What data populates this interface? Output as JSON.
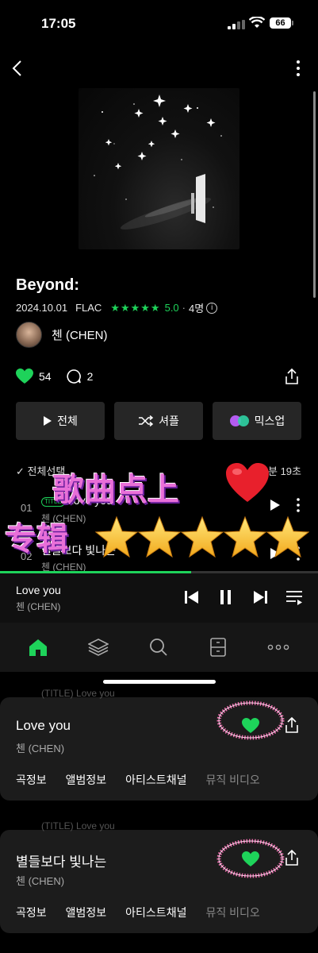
{
  "status": {
    "time": "17:05",
    "battery": "66"
  },
  "album": {
    "title": "Beyond:",
    "date": "2024.10.01",
    "format": "FLAC",
    "stars": "★★★★★",
    "rating": "5.0",
    "raters": "4명",
    "artist": "첸 (CHEN)",
    "likes": "54",
    "comments": "2"
  },
  "buttons": {
    "play_all": "전체",
    "shuffle": "셔플",
    "mixup": "믹스업"
  },
  "list": {
    "select_all": "전체선택",
    "duration": "곡 분 19초"
  },
  "tracks": [
    {
      "num": "01",
      "tag": "TITLE",
      "name": "Love you",
      "artist": "첸 (CHEN)"
    },
    {
      "num": "02",
      "name": "별들보다 빛나는",
      "artist": "첸 (CHEN)"
    }
  ],
  "overlay": {
    "line1": "歌曲点上",
    "line2": "专辑"
  },
  "progress": 0.6,
  "mini_player": {
    "song": "Love you",
    "artist": "첸 (CHEN)"
  },
  "cards": [
    {
      "peek_tag": "TITLE",
      "peek_name": "Love you",
      "title": "Love you",
      "artist": "첸 (CHEN)",
      "links": [
        "곡정보",
        "앨범정보",
        "아티스트채널",
        "뮤직 비디오"
      ]
    },
    {
      "peek_tag": "TITLE",
      "peek_name": "Love you",
      "title": "별들보다 빛나는",
      "artist": "첸 (CHEN)",
      "links": [
        "곡정보",
        "앨범정보",
        "아티스트채널",
        "뮤직 비디오"
      ]
    }
  ],
  "colors": {
    "accent": "#1ed35a",
    "overlay_text": "#e86fd8",
    "ring": "#f06fb0"
  },
  "icons": [
    "back-arrow-icon",
    "more-vertical-icon",
    "heart-icon",
    "comment-icon",
    "share-icon",
    "play-icon",
    "shuffle-icon",
    "mixup-icon",
    "check-icon",
    "prev-icon",
    "pause-icon",
    "next-icon",
    "playlist-icon",
    "home-icon",
    "layers-icon",
    "search-icon",
    "storage-icon",
    "more-horizontal-icon"
  ]
}
